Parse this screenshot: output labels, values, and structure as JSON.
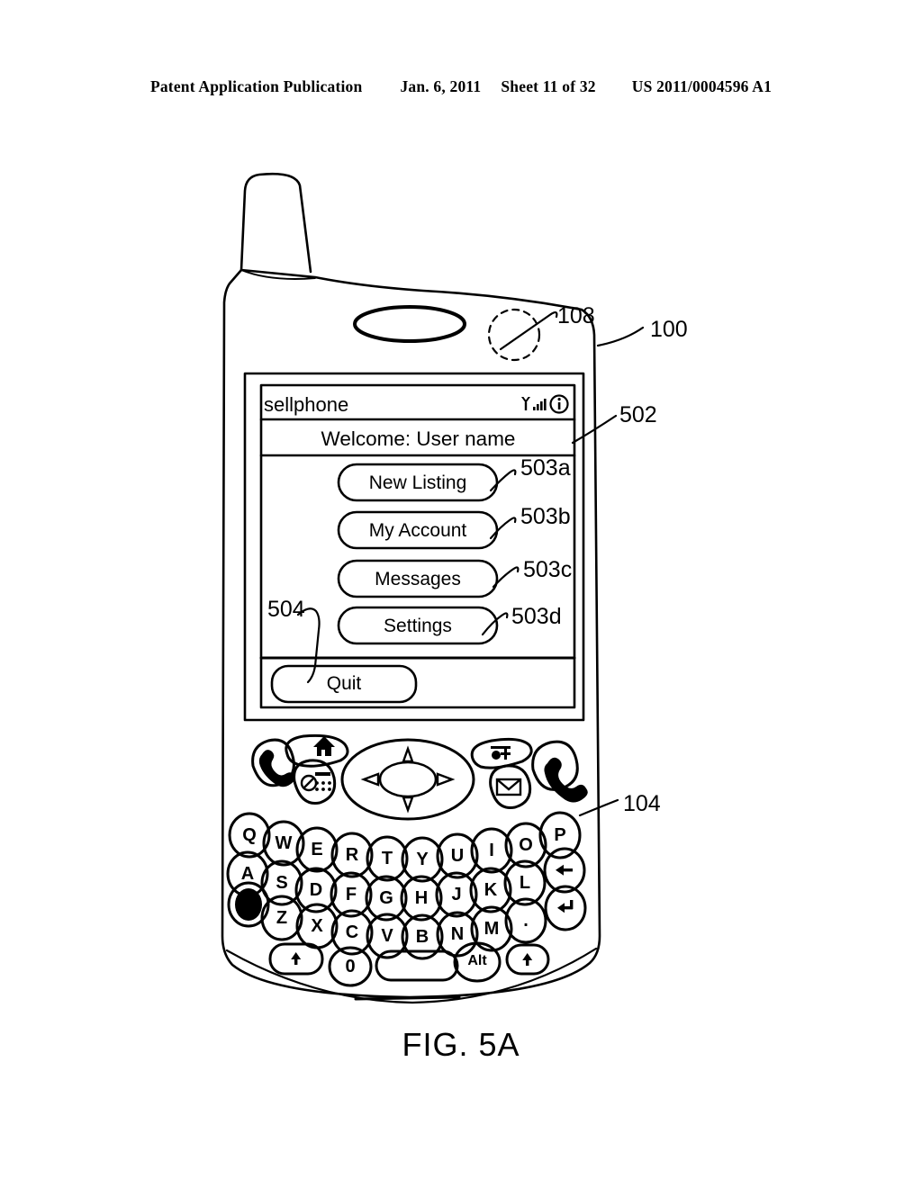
{
  "page_header": {
    "publication": "Patent Application Publication",
    "date": "Jan. 6, 2011",
    "sheet": "Sheet 11 of 32",
    "pub_number": "US 2011/0004596 A1"
  },
  "figure": {
    "caption": "FIG. 5A"
  },
  "device": {
    "reference_body": "100",
    "reference_camera": "108",
    "reference_keypad": "104",
    "screen": {
      "titlebar": {
        "app_name": "sellphone",
        "icons": [
          "signal-antenna-icon",
          "signal-bars-icon",
          "info-circle-icon"
        ]
      },
      "welcome_bar": {
        "text": "Welcome: User name",
        "reference": "502"
      },
      "menu": {
        "items": [
          {
            "label": "New Listing",
            "reference": "503a"
          },
          {
            "label": "My Account",
            "reference": "503b"
          },
          {
            "label": "Messages",
            "reference": "503c"
          },
          {
            "label": "Settings",
            "reference": "503d"
          }
        ]
      },
      "softkey_bar": {
        "quit_label": "Quit",
        "reference": "504"
      }
    },
    "function_keys": [
      {
        "name": "send-call-key",
        "icon": "handset-icon"
      },
      {
        "name": "home-key",
        "icon": "house-icon"
      },
      {
        "name": "dialpad-key",
        "icon": "dialpad-icon"
      },
      {
        "name": "navigation-pad",
        "icon": "dpad-icon"
      },
      {
        "name": "menu-key",
        "icon": "menu-plus-icon"
      },
      {
        "name": "message-key",
        "icon": "envelope-icon"
      },
      {
        "name": "end-call-key",
        "icon": "handset-power-icon"
      }
    ],
    "keyboard": {
      "row1": [
        "Q",
        "W",
        "E",
        "R",
        "T",
        "Y",
        "U",
        "I",
        "O",
        "P"
      ],
      "row2": [
        "A",
        "S",
        "D",
        "F",
        "G",
        "H",
        "J",
        "K",
        "L"
      ],
      "row2_end": "backspace-icon",
      "row3_start": "shift-filled-key",
      "row3": [
        "Z",
        "X",
        "C",
        "V",
        "B",
        "N",
        "M",
        "."
      ],
      "row3_end": "return-icon",
      "row4": [
        "shift-up-icon",
        "0",
        "space",
        "Alt",
        "shift-up-icon"
      ]
    }
  },
  "colors": {
    "ink": "#000000",
    "paper": "#ffffff"
  }
}
